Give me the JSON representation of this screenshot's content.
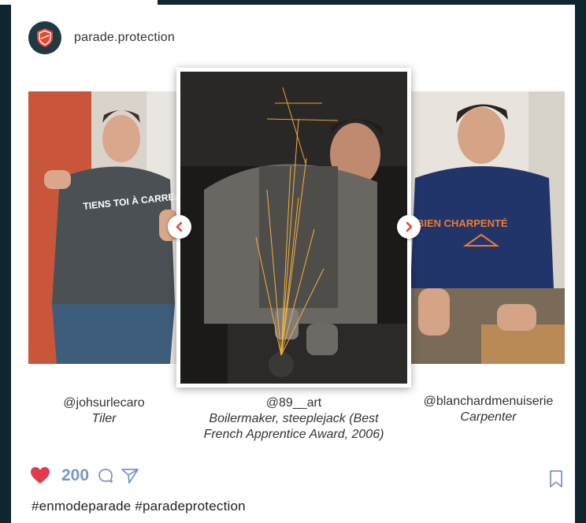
{
  "post": {
    "account": "parade.protection",
    "likes": "200",
    "hashtags": "#enmodeparade #paradeprotection"
  },
  "slides": [
    {
      "handle": "@johsurlecaro",
      "role": "Tiler",
      "shirt_text": "TIENS TOI À CARREAUX"
    },
    {
      "handle": "@89__art",
      "role": "Boilermaker, steeplejack (Best French Apprentice Award, 2006)"
    },
    {
      "handle": "@blanchardmenuiserie",
      "role": "Carpenter",
      "shirt_text": "BIEN CHARPENTÉ"
    }
  ],
  "icons": {
    "avatar": "parade-shield-logo",
    "prev": "chevron-left-icon",
    "next": "chevron-right-icon",
    "like": "heart-icon",
    "comment": "comment-icon",
    "share": "send-icon",
    "save": "bookmark-icon"
  },
  "colors": {
    "background": "#0f2530",
    "accent": "#e2492f",
    "like": "#e23a4e",
    "likes_text": "#7d95c9",
    "icon": "#7d95c9"
  }
}
